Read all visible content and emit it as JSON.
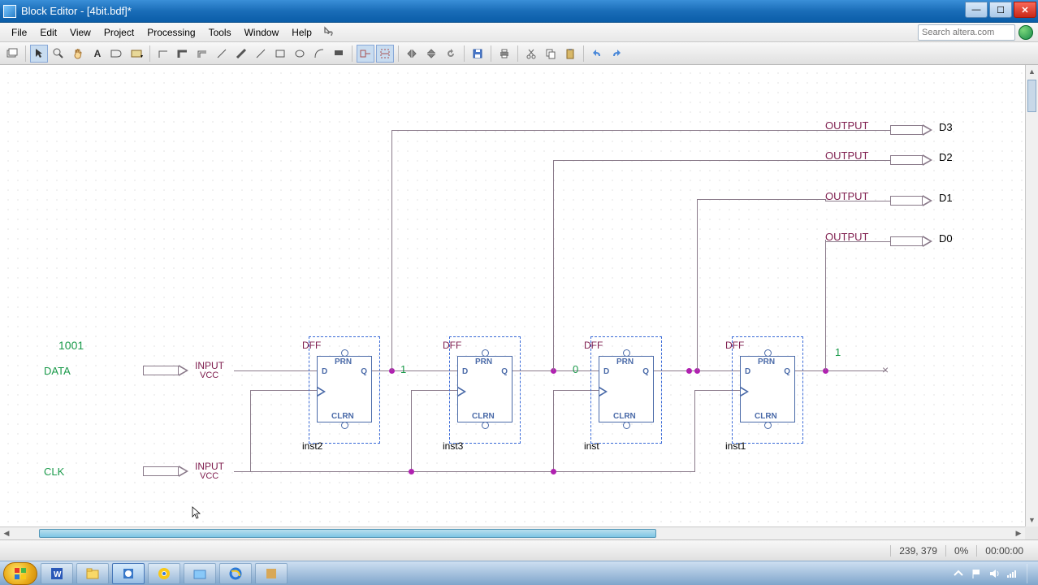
{
  "window": {
    "title": "Block Editor - [4bit.bdf]*"
  },
  "menu": {
    "items": [
      "File",
      "Edit",
      "View",
      "Project",
      "Processing",
      "Tools",
      "Window",
      "Help"
    ]
  },
  "search": {
    "placeholder": "Search altera.com"
  },
  "toolbar": {
    "tools": [
      "detach-window",
      "selection",
      "zoom",
      "hand",
      "text",
      "symbol",
      "block",
      "bus",
      "rubberband",
      "line-ortho",
      "line-45",
      "line-diag",
      "line",
      "line-dash",
      "rect",
      "oval",
      "arc",
      "fill",
      "partial-on",
      "partial-off",
      "find",
      "prev",
      "next",
      "up",
      "save",
      "print",
      "cut",
      "copy",
      "paste",
      "undo",
      "redo"
    ]
  },
  "schematic": {
    "note": "1001",
    "inputs": [
      {
        "name": "DATA",
        "type": "INPUT",
        "tie": "VCC"
      },
      {
        "name": "CLK",
        "type": "INPUT",
        "tie": "VCC"
      }
    ],
    "outputs": [
      {
        "label": "OUTPUT",
        "name": "D3"
      },
      {
        "label": "OUTPUT",
        "name": "D2"
      },
      {
        "label": "OUTPUT",
        "name": "D1"
      },
      {
        "label": "OUTPUT",
        "name": "D0"
      }
    ],
    "dffs": [
      {
        "type": "DFF",
        "prn": "PRN",
        "clrn": "CLRN",
        "d": "D",
        "q": "Q",
        "inst": "inst2"
      },
      {
        "type": "DFF",
        "prn": "PRN",
        "clrn": "CLRN",
        "d": "D",
        "q": "Q",
        "inst": "inst3"
      },
      {
        "type": "DFF",
        "prn": "PRN",
        "clrn": "CLRN",
        "d": "D",
        "q": "Q",
        "inst": "inst"
      },
      {
        "type": "DFF",
        "prn": "PRN",
        "clrn": "CLRN",
        "d": "D",
        "q": "Q",
        "inst": "inst1"
      }
    ],
    "wire_values": [
      "1",
      "0",
      "1"
    ]
  },
  "status": {
    "coords": "239, 379",
    "zoom": "0%",
    "time": "00:00:00"
  },
  "taskbar": {
    "apps": [
      "word",
      "explorer",
      "quartus",
      "chrome",
      "folder",
      "ie",
      "app"
    ],
    "tray_time": ""
  }
}
